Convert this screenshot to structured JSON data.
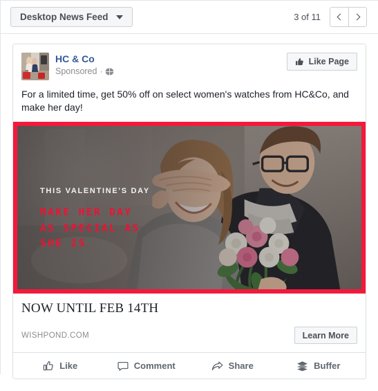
{
  "toolbar": {
    "placement_label": "Desktop News Feed",
    "caret_icon": "chevron-down-icon",
    "page_count": "3 of 11",
    "prev_icon": "chevron-left-icon",
    "next_icon": "chevron-right-icon"
  },
  "post": {
    "avatar_alt": "two-women-with-red-luggage-thumbnail",
    "page_name": "HC & Co",
    "sponsored_label": "Sponsored",
    "meta_separator": "·",
    "audience_icon": "globe-icon",
    "like_page_label": "Like Page",
    "like_page_icon": "thumbs-up-icon",
    "body_text": "For a limited time, get 50% off on select women's watches from HC&Co, and make her day!"
  },
  "creative": {
    "border_color": "#f5183b",
    "photo_alt": "man-covering-smiling-womans-eyes-holding-rose-bouquet",
    "overlay_kicker": "THIS VALENTINE'S DAY",
    "overlay_headline_line1": "MAKE HER DAY",
    "overlay_headline_line2": "AS SPECIAL AS",
    "overlay_headline_line3": "SHE IS",
    "overlay_headline_color": "#ef1233",
    "overlay_kicker_color": "#f2f2f2"
  },
  "link": {
    "title": "NOW UNTIL FEB 14TH",
    "domain": "WISHPOND.COM",
    "cta_label": "Learn More"
  },
  "actions": [
    {
      "label": "Like",
      "icon": "thumbs-up-outline-icon"
    },
    {
      "label": "Comment",
      "icon": "speech-bubble-icon"
    },
    {
      "label": "Share",
      "icon": "share-arrow-icon"
    },
    {
      "label": "Buffer",
      "icon": "stacked-layers-icon"
    }
  ]
}
